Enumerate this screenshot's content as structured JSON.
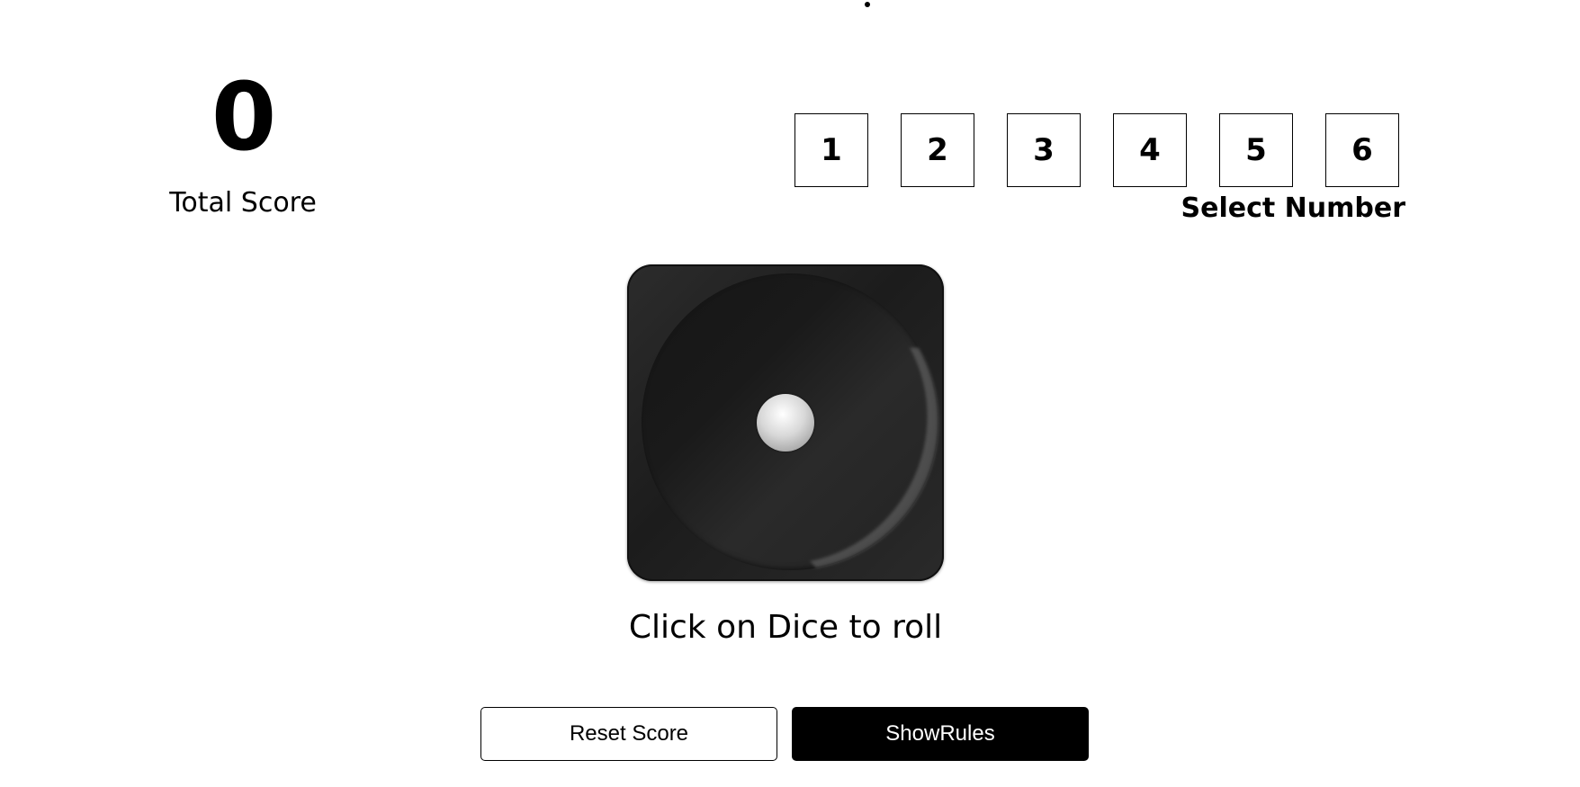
{
  "score": {
    "value": "0",
    "label": "Total Score"
  },
  "number_selector": {
    "options": [
      "1",
      "2",
      "3",
      "4",
      "5",
      "6"
    ],
    "label": "Select Number"
  },
  "dice": {
    "face_value": 1,
    "hint": "Click on Dice to roll"
  },
  "buttons": {
    "reset_label": "Reset Score",
    "rules_label": "ShowRules"
  },
  "colors": {
    "primary": "#000000",
    "background": "#ffffff",
    "dice_body": "#222222"
  }
}
